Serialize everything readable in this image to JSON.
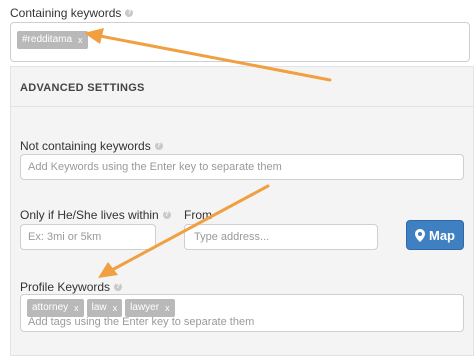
{
  "containing": {
    "label": "Containing keywords",
    "tags": [
      "#redditama"
    ]
  },
  "advanced": {
    "title": "ADVANCED SETTINGS"
  },
  "not_containing": {
    "label": "Not containing keywords",
    "placeholder": "Add Keywords using the Enter key to separate them"
  },
  "lives_within": {
    "label": "Only if He/She lives within",
    "placeholder": "Ex: 3mi or 5km"
  },
  "from": {
    "label": "From",
    "placeholder": "Type address..."
  },
  "map_button": {
    "label": "Map"
  },
  "profile_keywords": {
    "label": "Profile Keywords",
    "tags": [
      "attorney",
      "law",
      "lawyer"
    ],
    "placeholder": "Add tags using the Enter key to separate them"
  },
  "tag_remove_symbol": "x",
  "help_symbol": "?",
  "colors": {
    "map_button": "#3f80c3",
    "tag_bg": "#b9b9b9",
    "annotation_arrow": "#f0a040"
  }
}
